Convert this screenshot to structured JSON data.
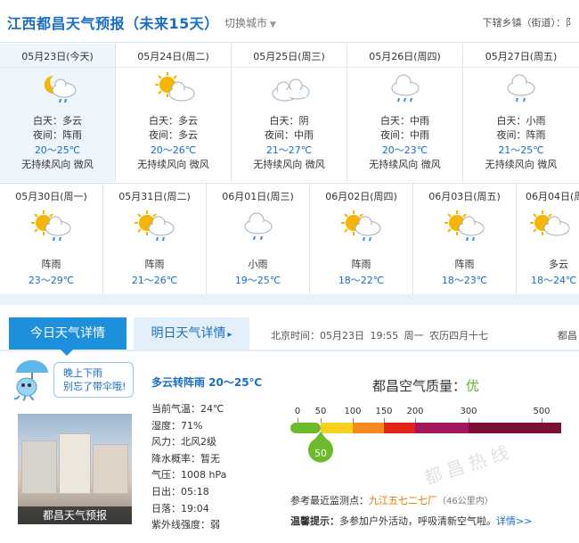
{
  "header": {
    "title": "江西都昌天气预报（未来15天）",
    "switch_city": "切换城市",
    "sub_area": "下辖乡镇（街道）：阝"
  },
  "forecast_row1": [
    {
      "date": "05月23日(今天)",
      "icon": "partly-cloudy-night-rain-icon",
      "day_label": "白天：多云",
      "night_label": "夜间：阵雨",
      "temp": "20～25℃",
      "wind": "无持续风向  微风"
    },
    {
      "date": "05月24日(周二)",
      "icon": "sun-cloud-icon",
      "day_label": "白天：多云",
      "night_label": "夜间：多云",
      "temp": "20～26℃",
      "wind": "无持续风向  微风"
    },
    {
      "date": "05月25日(周三)",
      "icon": "overcast-icon",
      "day_label": "白天：阴",
      "night_label": "夜间：中雨",
      "temp": "21～27℃",
      "wind": "无持续风向  微风"
    },
    {
      "date": "05月26日(周四)",
      "icon": "rain-cloud-icon",
      "day_label": "白天：中雨",
      "night_label": "夜间：中雨",
      "temp": "20～23℃",
      "wind": "无持续风向  微风"
    },
    {
      "date": "05月27日(周五)",
      "icon": "rain-cloud-icon",
      "day_label": "白天：小雨",
      "night_label": "夜间：阵雨",
      "temp": "21～25℃",
      "wind": "无持续风向  微风"
    }
  ],
  "forecast_row2": [
    {
      "date": "05月30日(周一)",
      "icon": "sun-cloud-rain-icon",
      "condition": "阵雨",
      "temp": "23～29℃"
    },
    {
      "date": "05月31日(周二)",
      "icon": "sun-cloud-rain-icon",
      "condition": "阵雨",
      "temp": "21～26℃"
    },
    {
      "date": "06月01日(周三)",
      "icon": "rain-cloud-icon",
      "condition": "小雨",
      "temp": "19～25℃"
    },
    {
      "date": "06月02日(周四)",
      "icon": "sun-cloud-rain-icon",
      "condition": "阵雨",
      "temp": "18～22℃"
    },
    {
      "date": "06月03日(周五)",
      "icon": "sun-cloud-rain-icon",
      "condition": "阵雨",
      "temp": "18～23℃"
    },
    {
      "date": "06月04日(周",
      "icon": "sun-cloud-icon",
      "condition": "多云",
      "temp": "18～24℃"
    }
  ],
  "tabs": {
    "today": "今日天气详情",
    "tomorrow": "明日天气详情"
  },
  "time_info": "北京时间：05月23日 19:55 周一 农历四月十七",
  "cut_city": "都昌",
  "tip": {
    "line1": "晚上下雨",
    "line2": "别忘了带伞哦!"
  },
  "photo_caption": "都昌天气预报",
  "today_detail": {
    "condition": "多云转阵雨  20～25℃",
    "current_temp": "当前气温：24℃",
    "humidity": "湿度：71%",
    "wind": "风力：北风2级",
    "precip": "降水概率：暂无",
    "pressure": "气压：1008 hPa",
    "sunrise": "日出：05:18",
    "sunset": "日落：19:04",
    "uv": "紫外线强度：弱"
  },
  "air_quality": {
    "label": "都昌空气质量：",
    "level": "优",
    "aqi": "50",
    "aqi_value": 50,
    "ticks": [
      "0",
      "50",
      "100",
      "150",
      "200",
      "300",
      "500"
    ],
    "colors": [
      "#6dbb2a",
      "#f7d11f",
      "#f48a1f",
      "#e2231a",
      "#a3165b",
      "#7a1130"
    ]
  },
  "reference": {
    "label": "参考最近监测点：",
    "station": "九江五七二七厂",
    "distance": "（46公里内）"
  },
  "warm_tip": {
    "label": "温馨提示：",
    "text": "多参加户外活动，呼吸清新空气啦。",
    "more": "详情>>"
  },
  "watermark": "都昌热线"
}
